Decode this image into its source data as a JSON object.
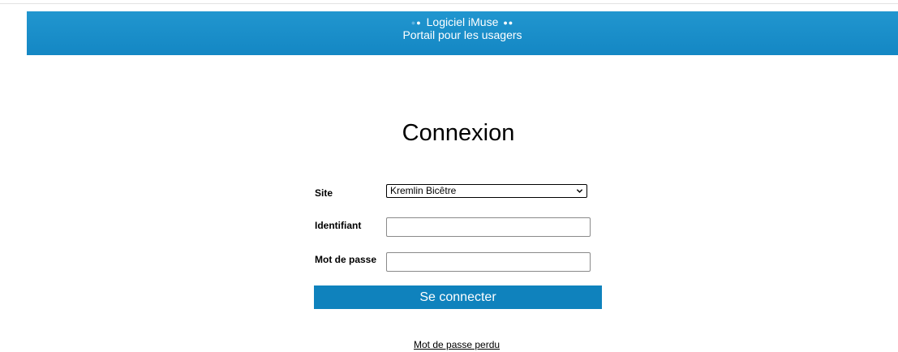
{
  "header": {
    "app_name": "Logiciel iMuse",
    "subtitle": "Portail pour les usagers",
    "decor_dots": "●●"
  },
  "page": {
    "title": "Connexion"
  },
  "form": {
    "site_label": "Site",
    "site_selected": "Kremlin Bicêtre",
    "identifier_label": "Identifiant",
    "identifier_value": "",
    "password_label": "Mot de passe",
    "password_value": "",
    "submit_label": "Se connecter",
    "lost_password_link": "Mot de passe perdu"
  },
  "colors": {
    "banner": "#1487c4",
    "button": "#0f82bd"
  }
}
